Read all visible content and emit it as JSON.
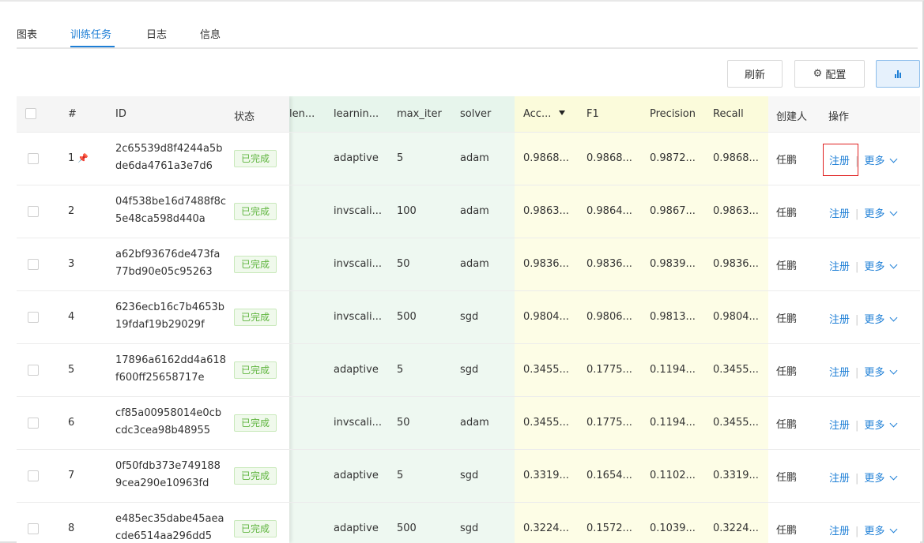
{
  "tabs": [
    {
      "label": "图表",
      "active": false
    },
    {
      "label": "训练任务",
      "active": true
    },
    {
      "label": "日志",
      "active": false
    },
    {
      "label": "信息",
      "active": false
    }
  ],
  "toolbar": {
    "refresh_label": "刷新",
    "config_label": "配置",
    "chart_icon": "bar-chart-icon"
  },
  "colors": {
    "accent": "#1e7fd6",
    "status_green": "#5fb53f",
    "highlight_red": "#e02020"
  },
  "table": {
    "headers": {
      "index": "#",
      "id": "ID",
      "status": "状态",
      "len": "len...",
      "learning": "learnin...",
      "max_iter": "max_iter",
      "solver": "solver",
      "acc": "Acc...",
      "f1": "F1",
      "precision": "Precision",
      "recall": "Recall",
      "creator": "创建人",
      "ops": "操作"
    },
    "rows": [
      {
        "num": "1",
        "pinned": true,
        "id1": "2c65539d8f4244a5b",
        "id2": "de6da4761a3e7d6",
        "status": "已完成",
        "learning": "adaptive",
        "max_iter": "5",
        "solver": "adam",
        "acc": "0.9868...",
        "f1": "0.9868...",
        "precision": "0.9872...",
        "recall": "0.9868...",
        "creator": "任鹏",
        "register": "注册",
        "more": "更多"
      },
      {
        "num": "2",
        "pinned": false,
        "id1": "04f538be16d7488f8c",
        "id2": "5e48ca598d440a",
        "status": "已完成",
        "learning": "invscali...",
        "max_iter": "100",
        "solver": "adam",
        "acc": "0.9863...",
        "f1": "0.9864...",
        "precision": "0.9867...",
        "recall": "0.9863...",
        "creator": "任鹏",
        "register": "注册",
        "more": "更多"
      },
      {
        "num": "3",
        "pinned": false,
        "id1": "a62bf93676de473fa",
        "id2": "77bd90e05c95263",
        "status": "已完成",
        "learning": "invscali...",
        "max_iter": "50",
        "solver": "adam",
        "acc": "0.9836...",
        "f1": "0.9836...",
        "precision": "0.9839...",
        "recall": "0.9836...",
        "creator": "任鹏",
        "register": "注册",
        "more": "更多"
      },
      {
        "num": "4",
        "pinned": false,
        "id1": "6236ecb16c7b4653b",
        "id2": "19fdaf19b29029f",
        "status": "已完成",
        "learning": "invscali...",
        "max_iter": "500",
        "solver": "sgd",
        "acc": "0.9804...",
        "f1": "0.9806...",
        "precision": "0.9813...",
        "recall": "0.9804...",
        "creator": "任鹏",
        "register": "注册",
        "more": "更多"
      },
      {
        "num": "5",
        "pinned": false,
        "id1": "17896a6162dd4a618",
        "id2": "f600ff25658717e",
        "status": "已完成",
        "learning": "adaptive",
        "max_iter": "5",
        "solver": "sgd",
        "acc": "0.3455...",
        "f1": "0.1775...",
        "precision": "0.1194...",
        "recall": "0.3455...",
        "creator": "任鹏",
        "register": "注册",
        "more": "更多"
      },
      {
        "num": "6",
        "pinned": false,
        "id1": "cf85a00958014e0cb",
        "id2": "cdc3cea98b48955",
        "status": "已完成",
        "learning": "invscali...",
        "max_iter": "50",
        "solver": "adam",
        "acc": "0.3455...",
        "f1": "0.1775...",
        "precision": "0.1194...",
        "recall": "0.3455...",
        "creator": "任鹏",
        "register": "注册",
        "more": "更多"
      },
      {
        "num": "7",
        "pinned": false,
        "id1": "0f50fdb373e749188",
        "id2": "9cea290e10963fd",
        "status": "已完成",
        "learning": "adaptive",
        "max_iter": "5",
        "solver": "sgd",
        "acc": "0.3319...",
        "f1": "0.1654...",
        "precision": "0.1102...",
        "recall": "0.3319...",
        "creator": "任鹏",
        "register": "注册",
        "more": "更多"
      },
      {
        "num": "8",
        "pinned": false,
        "id1": "e485ec35dabe45aea",
        "id2": "cde6514aa296dd5",
        "status": "已完成",
        "learning": "adaptive",
        "max_iter": "500",
        "solver": "sgd",
        "acc": "0.3224...",
        "f1": "0.1572...",
        "precision": "0.1039...",
        "recall": "0.3224...",
        "creator": "任鹏",
        "register": "注册",
        "more": "更多"
      }
    ]
  }
}
